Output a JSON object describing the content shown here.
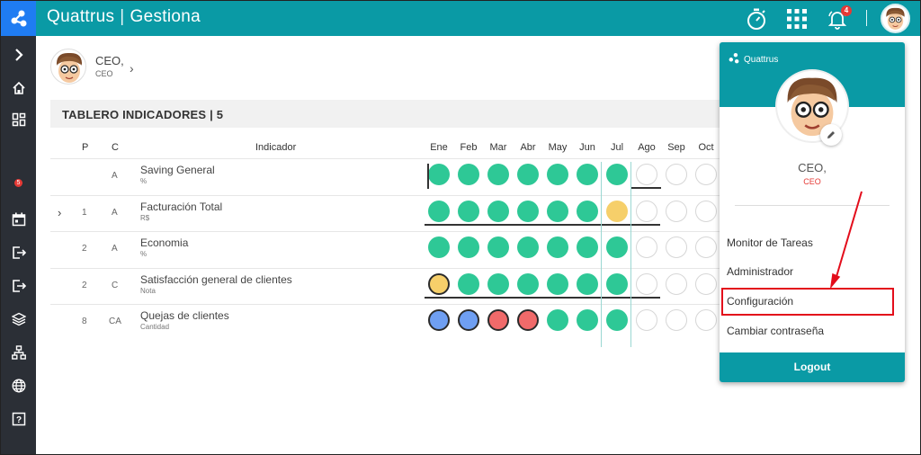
{
  "topbar": {
    "app_name": "Quattrus",
    "separator": "|",
    "module": "Gestiona",
    "notification_count": "4",
    "icons": [
      "logo-icon",
      "stopwatch-icon",
      "apps-grid-icon",
      "bell-icon",
      "user-avatar"
    ]
  },
  "sidebar": {
    "badge": "5",
    "items": [
      "expand-icon",
      "home-icon",
      "dashboard-icon",
      "calendar-icon",
      "login-icon",
      "logout-icon",
      "layers-icon",
      "org-icon",
      "globe-icon",
      "help-icon"
    ]
  },
  "user": {
    "name": "CEO,",
    "role": "CEO"
  },
  "panel": {
    "title": "TABLERO INDICADORES | 5"
  },
  "table": {
    "headers": {
      "p": "P",
      "c": "C",
      "indicador": "Indicador"
    },
    "months": [
      "Ene",
      "Feb",
      "Mar",
      "Abr",
      "May",
      "Jun",
      "Jul",
      "Ago",
      "Sep",
      "Oct"
    ],
    "rows": [
      {
        "p": "",
        "c": "A",
        "name": "Saving General",
        "unit": "%",
        "expand": false,
        "status": [
          "green",
          "green",
          "green",
          "green",
          "green",
          "green",
          "green",
          "empty",
          "empty",
          "empty"
        ]
      },
      {
        "p": "1",
        "c": "A",
        "name": "Facturación Total",
        "unit": "R$",
        "expand": true,
        "status": [
          "green",
          "green",
          "green",
          "green",
          "green",
          "green",
          "yellow",
          "empty",
          "empty",
          "empty"
        ]
      },
      {
        "p": "2",
        "c": "A",
        "name": "Economia",
        "unit": "%",
        "expand": false,
        "status": [
          "green",
          "green",
          "green",
          "green",
          "green",
          "green",
          "green",
          "empty",
          "empty",
          "empty"
        ]
      },
      {
        "p": "2",
        "c": "C",
        "name": "Satisfacción general de clientes",
        "unit": "Nota",
        "expand": false,
        "status": [
          "yellow",
          "green",
          "green",
          "green",
          "green",
          "green",
          "green",
          "empty",
          "empty",
          "empty"
        ]
      },
      {
        "p": "8",
        "c": "CA",
        "name": "Quejas de clientes",
        "unit": "Cantidad",
        "expand": false,
        "status": [
          "blue",
          "blue",
          "red",
          "red",
          "green",
          "green",
          "green",
          "empty",
          "empty",
          "empty"
        ]
      }
    ]
  },
  "dropdown": {
    "brand": "Quattrus",
    "name": "CEO,",
    "role": "CEO",
    "items": [
      "Monitor de Tareas",
      "Administrador",
      "Configuración",
      "Cambiar contraseña"
    ],
    "logout": "Logout"
  },
  "colors": {
    "teal": "#0a9aa5",
    "sidebar": "#2b2f36",
    "green": "#2ec896",
    "yellow": "#f6cf6a",
    "blue": "#6f9ff2",
    "red": "#f06a6a",
    "highlight": "#e30d1b"
  }
}
